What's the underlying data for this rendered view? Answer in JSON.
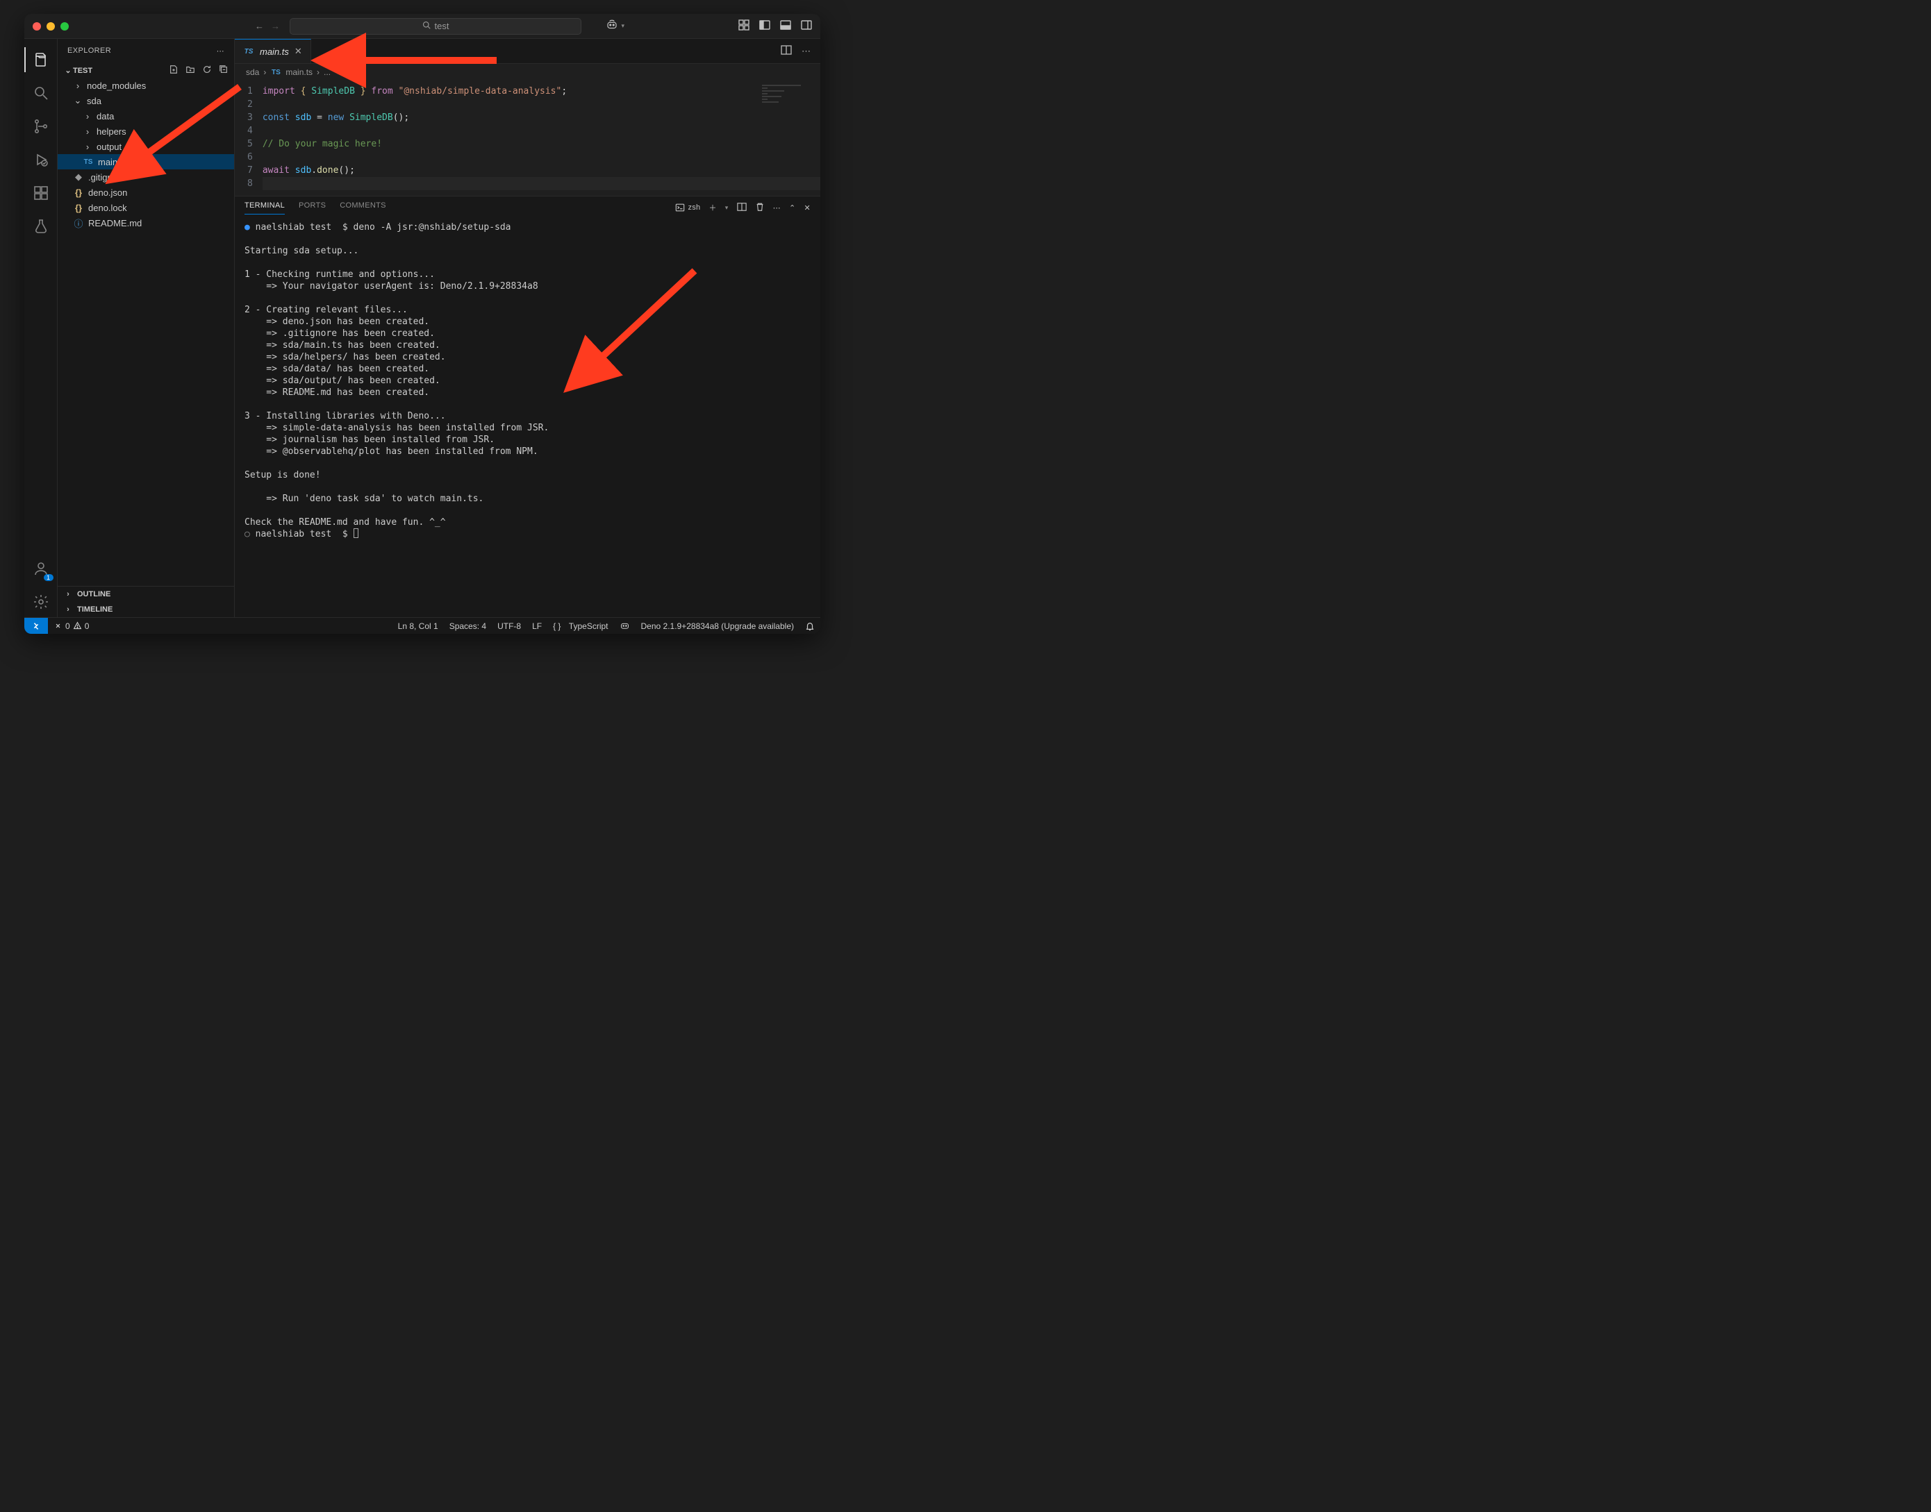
{
  "titlebar": {
    "search": "test"
  },
  "sidebar": {
    "title": "EXPLORER",
    "project": "TEST",
    "outline": "OUTLINE",
    "timeline": "TIMELINE",
    "tree": [
      {
        "depth": 1,
        "type": "folder",
        "chev": "closed",
        "label": "node_modules"
      },
      {
        "depth": 1,
        "type": "folder",
        "chev": "open",
        "label": "sda"
      },
      {
        "depth": 2,
        "type": "folder",
        "chev": "closed",
        "label": "data"
      },
      {
        "depth": 2,
        "type": "folder",
        "chev": "closed",
        "label": "helpers"
      },
      {
        "depth": 2,
        "type": "folder",
        "chev": "closed",
        "label": "output"
      },
      {
        "depth": 2,
        "type": "file",
        "icon": "ts",
        "label": "main.ts",
        "selected": true
      },
      {
        "depth": 1,
        "type": "file",
        "icon": "git",
        "label": ".gitignore"
      },
      {
        "depth": 1,
        "type": "file",
        "icon": "json",
        "label": "deno.json"
      },
      {
        "depth": 1,
        "type": "file",
        "icon": "json",
        "label": "deno.lock"
      },
      {
        "depth": 1,
        "type": "file",
        "icon": "info",
        "label": "README.md"
      }
    ]
  },
  "account_badge": "1",
  "tab": {
    "label": "main.ts"
  },
  "breadcrumb": {
    "p0": "sda",
    "p1": "main.ts",
    "p2": "..."
  },
  "code": {
    "lines": [
      "1",
      "2",
      "3",
      "4",
      "5",
      "6",
      "7",
      "8"
    ],
    "l1_import": "import",
    "l1_ob": "{ ",
    "l1_type": "SimpleDB",
    "l1_cb": " }",
    "l1_from": " from ",
    "l1_str": "\"@nshiab/simple-data-analysis\"",
    "l1_semi": ";",
    "l3_const": "const ",
    "l3_var": "sdb",
    "l3_eq": " = ",
    "l3_new": "new ",
    "l3_type": "SimpleDB",
    "l3_paren": "();",
    "l5_comment": "// Do your magic here!",
    "l7_await": "await ",
    "l7_var": "sdb",
    "l7_dot": ".",
    "l7_fn": "done",
    "l7_paren": "();"
  },
  "panel": {
    "tabs": {
      "terminal": "TERMINAL",
      "ports": "PORTS",
      "comments": "COMMENTS"
    },
    "shell": "zsh"
  },
  "terminal": {
    "prompt1_user": "naelshiab",
    "prompt1_dir": "test",
    "prompt1_cmd": "deno -A jsr:@nshiab/setup-sda",
    "lines": [
      "",
      "Starting sda setup...",
      "",
      "1 - Checking runtime and options...",
      "    => Your navigator userAgent is: Deno/2.1.9+28834a8",
      "",
      "2 - Creating relevant files...",
      "    => deno.json has been created.",
      "    => .gitignore has been created.",
      "    => sda/main.ts has been created.",
      "    => sda/helpers/ has been created.",
      "    => sda/data/ has been created.",
      "    => sda/output/ has been created.",
      "    => README.md has been created.",
      "",
      "3 - Installing libraries with Deno...",
      "    => simple-data-analysis has been installed from JSR.",
      "    => journalism has been installed from JSR.",
      "    => @observablehq/plot has been installed from NPM.",
      "",
      "Setup is done!",
      "",
      "    => Run 'deno task sda' to watch main.ts.",
      "",
      "Check the README.md and have fun. ^_^"
    ],
    "prompt2_user": "naelshiab",
    "prompt2_dir": "test"
  },
  "status": {
    "errors": "0",
    "warnings": "0",
    "lncol": "Ln 8, Col 1",
    "spaces": "Spaces: 4",
    "encoding": "UTF-8",
    "eol": "LF",
    "lang": "TypeScript",
    "deno": "Deno 2.1.9+28834a8 (Upgrade available)"
  }
}
